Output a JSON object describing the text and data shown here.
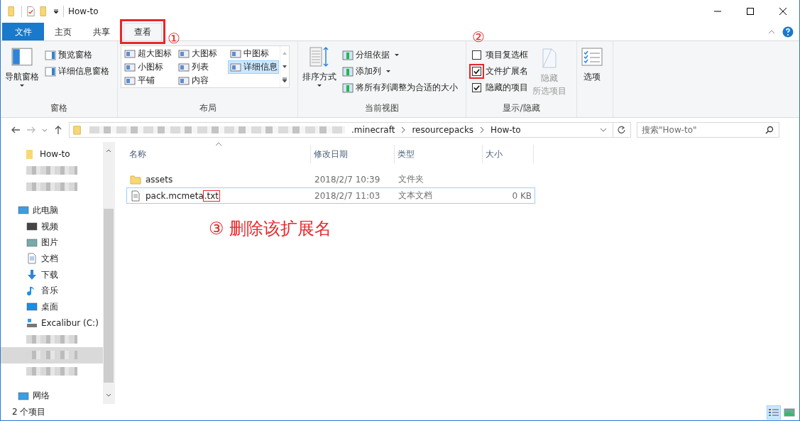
{
  "window": {
    "title": "How-to"
  },
  "ribbon": {
    "tabs": [
      {
        "label": "文件",
        "kind": "file",
        "selected": false,
        "highlighted": false
      },
      {
        "label": "主页",
        "kind": "tab",
        "selected": false,
        "highlighted": false
      },
      {
        "label": "共享",
        "kind": "tab",
        "selected": false,
        "highlighted": false
      },
      {
        "label": "查看",
        "kind": "tab",
        "selected": true,
        "highlighted": true
      }
    ],
    "panes": {
      "label": "窗格",
      "large": "导航窗格",
      "small": [
        "预览窗格",
        "详细信息窗格"
      ]
    },
    "layout": {
      "label": "布局",
      "options": [
        {
          "label": "超大图标",
          "selected": false
        },
        {
          "label": "大图标",
          "selected": false
        },
        {
          "label": "中图标",
          "selected": false
        },
        {
          "label": "小图标",
          "selected": false
        },
        {
          "label": "列表",
          "selected": false
        },
        {
          "label": "详细信息",
          "selected": true
        },
        {
          "label": "平铺",
          "selected": false
        },
        {
          "label": "内容",
          "selected": false
        }
      ]
    },
    "current_view": {
      "label": "当前视图",
      "large": "排序方式",
      "small": [
        {
          "label": "分组依据",
          "dropdown": true
        },
        {
          "label": "添加列",
          "dropdown": true
        },
        {
          "label": "将所有列调整为合适的大小",
          "dropdown": false
        }
      ]
    },
    "show_hide": {
      "label": "显示/隐藏",
      "checkboxes": [
        {
          "label": "项目复选框",
          "checked": false,
          "highlighted": false
        },
        {
          "label": "文件扩展名",
          "checked": true,
          "highlighted": true
        },
        {
          "label": "隐藏的项目",
          "checked": true,
          "highlighted": false
        }
      ],
      "hide_button": {
        "lines": [
          "隐藏",
          "所选项目"
        ],
        "disabled": true
      }
    },
    "options": {
      "label": "选项"
    }
  },
  "annotations": {
    "tab_mark": "①",
    "checkbox_mark": "②",
    "instruction": "③ 删除该扩展名"
  },
  "address": {
    "path": [
      ".minecraft",
      "resourcepacks",
      "How-to"
    ]
  },
  "search": {
    "placeholder": "搜索\"How-to\""
  },
  "nav": [
    {
      "label": "How-to",
      "kind": "folder",
      "selected": false
    },
    {
      "kind": "blurred",
      "selected": false
    },
    {
      "kind": "blurred",
      "selected": false
    },
    {
      "label": "此电脑",
      "kind": "pc",
      "selected": false,
      "children": [
        {
          "label": "视频",
          "kind": "video",
          "selected": false
        },
        {
          "label": "图片",
          "kind": "pictures",
          "selected": false
        },
        {
          "label": "文档",
          "kind": "documents",
          "selected": false
        },
        {
          "label": "下载",
          "kind": "downloads",
          "selected": false
        },
        {
          "label": "音乐",
          "kind": "music",
          "selected": false
        },
        {
          "label": "桌面",
          "kind": "desktop",
          "selected": false
        },
        {
          "label": "Excalibur (C:)",
          "kind": "drive",
          "selected": false
        },
        {
          "kind": "blurred",
          "selected": false
        },
        {
          "kind": "blurred",
          "selected": true
        },
        {
          "kind": "blurred",
          "selected": false
        }
      ]
    },
    {
      "label": "网络",
      "kind": "network",
      "selected": false
    }
  ],
  "files": {
    "columns": [
      {
        "label": "名称",
        "sorted": true
      },
      {
        "label": "修改日期",
        "sorted": false
      },
      {
        "label": "类型",
        "sorted": false
      },
      {
        "label": "大小",
        "sorted": false
      }
    ],
    "rows": [
      {
        "name": "assets",
        "kind": "folder",
        "date": "2018/2/7 10:39",
        "type": "文件夹",
        "focused": false
      },
      {
        "name": "pack.mcmeta",
        "extension": ".txt",
        "extension_highlighted": true,
        "kind": "text",
        "date": "2018/2/7 11:03",
        "type": "文本文档",
        "size": "0 KB",
        "focused": true
      }
    ]
  },
  "status_bar": {
    "count": "2 个项目",
    "views": [
      {
        "kind": "details",
        "selected": true
      },
      {
        "kind": "large",
        "selected": false
      }
    ]
  }
}
